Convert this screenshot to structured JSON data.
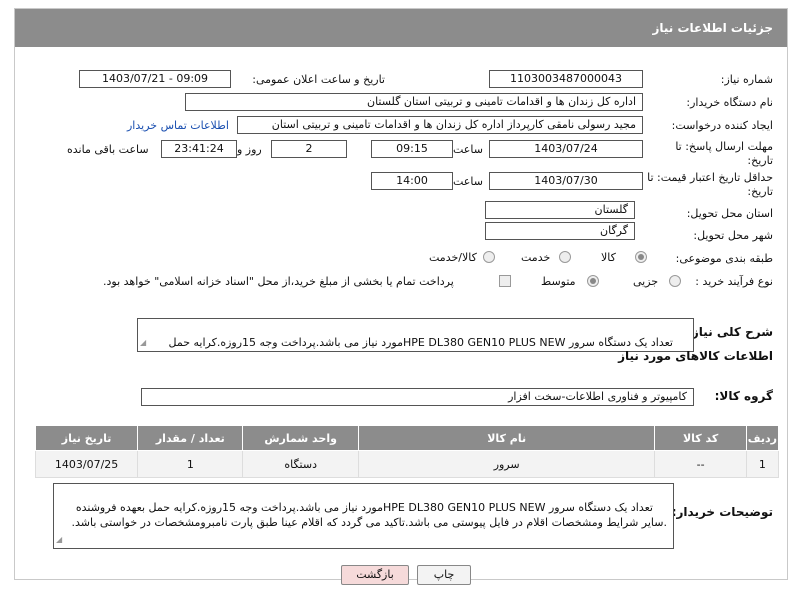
{
  "header": {
    "title": "جزئیات اطلاعات نیاز"
  },
  "form": {
    "need_number_label": "شماره نیاز:",
    "need_number": "1103003487000043",
    "announce_label": "تاریخ و ساعت اعلان عمومی:",
    "announce_value": "1403/07/21 - 09:09",
    "buyer_label": "نام دستگاه خریدار:",
    "buyer_value": "اداره کل زندان ها و اقدامات تامینی و تربیتی استان گلستان",
    "creator_label": "ایجاد کننده درخواست:",
    "creator_value": "مجید رسولی نامقی کارپرداز اداره کل زندان ها و اقدامات تامینی و تربیتی استان",
    "contact_link": "اطلاعات تماس خریدار",
    "deadline_label": "مهلت ارسال پاسخ: تا تاریخ:",
    "deadline_date": "1403/07/24",
    "hour_label": "ساعت",
    "deadline_time": "09:15",
    "days_value": "2",
    "days_label": "روز و",
    "remaining_time": "23:41:24",
    "remaining_label": "ساعت باقی مانده",
    "validity_label": "حداقل تاریخ اعتبار قیمت: تا تاریخ:",
    "validity_date": "1403/07/30",
    "validity_hour_label": "ساعت",
    "validity_time": "14:00",
    "province_label": "استان محل تحویل:",
    "province_value": "گلستان",
    "city_label": "شهر محل تحویل:",
    "city_value": "گرگان",
    "category_label": "طبقه بندی موضوعی:",
    "category_options": [
      "کالا",
      "خدمت",
      "کالا/خدمت"
    ],
    "process_label": "نوع فرآیند خرید :",
    "process_options": [
      "جزیی",
      "متوسط"
    ],
    "payment_note": "پرداخت تمام یا بخشی از مبلغ خرید،از محل \"اسناد خزانه اسلامی\" خواهد بود.",
    "description_label": "شرح کلی نیاز:",
    "description_value": "تعداد یک دستگاه سرور HPE DL380 GEN10 PLUS NEWمورد نیاز می باشد.پرداخت وجه 15روزه.کرایه حمل بعهده فروشنده .سایر شرایط ومشخصات اقلام در فایل پیوستی"
  },
  "goods": {
    "section_title": "اطلاعات کالاهای مورد نیاز",
    "group_label": "گروه کالا:",
    "group_value": "کامپیوتر و فناوری اطلاعات-سخت افزار",
    "table": {
      "headers": [
        "ردیف",
        "کد کالا",
        "نام کالا",
        "واحد شمارش",
        "تعداد / مقدار",
        "تاریخ نیاز"
      ],
      "rows": [
        [
          "1",
          "--",
          "سرور",
          "دستگاه",
          "1",
          "1403/07/25"
        ]
      ]
    }
  },
  "buyer_notes": {
    "label": "توضیحات خریدار:",
    "value": "تعداد یک دستگاه سرور HPE DL380 GEN10 PLUS NEWمورد نیاز می باشد.پرداخت وجه 15روزه.کرایه حمل بعهده فروشنده .سایر شرایط ومشخصات اقلام در فایل پیوستی می باشد.تاکید می گردد که اقلام عینا طبق پارت نامبرومشخصات در خواستی باشد."
  },
  "buttons": {
    "print": "چاپ",
    "back": "بازگشت"
  },
  "colors": {
    "header_bg": "#8c8c8c",
    "link": "#1a4fb0",
    "back_button_bg": "#f6dada"
  }
}
